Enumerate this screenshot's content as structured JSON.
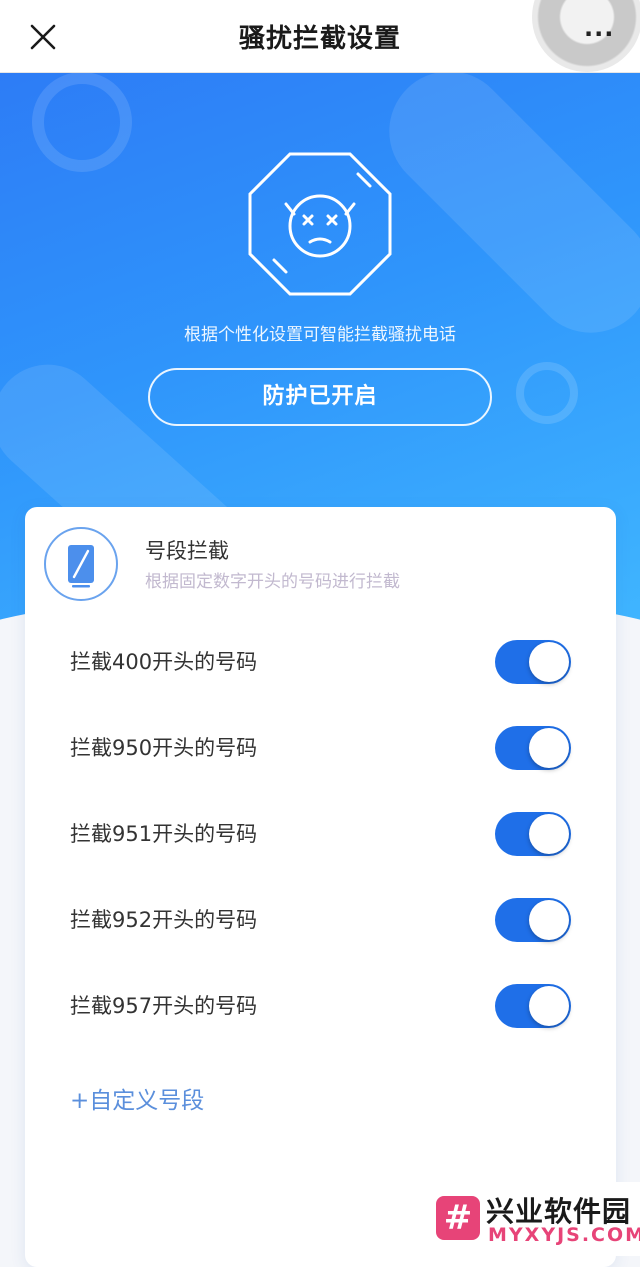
{
  "nav": {
    "title": "骚扰拦截设置",
    "more": "···"
  },
  "hero": {
    "description": "根据个性化设置可智能拦截骚扰电话",
    "status_button": "防护已开启"
  },
  "section": {
    "title": "号段拦截",
    "subtitle": "根据固定数字开头的号码进行拦截",
    "items": [
      {
        "label": "拦截400开头的号码",
        "enabled": true
      },
      {
        "label": "拦截950开头的号码",
        "enabled": true
      },
      {
        "label": "拦截951开头的号码",
        "enabled": true
      },
      {
        "label": "拦截952开头的号码",
        "enabled": true
      },
      {
        "label": "拦截957开头的号码",
        "enabled": true
      }
    ],
    "add_custom": "+自定义号段"
  },
  "watermark": {
    "logo": "#",
    "title": "兴业软件园",
    "subtitle": "MYXYJS.COM"
  },
  "colors": {
    "accent": "#1f6fe8",
    "hero_start": "#2d7cf6",
    "hero_end": "#40b6ff"
  }
}
